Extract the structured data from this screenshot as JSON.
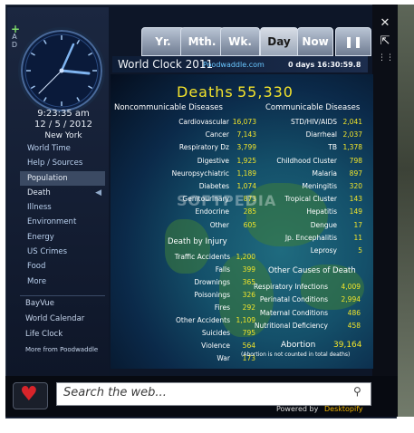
{
  "window_controls": {
    "close": "✕",
    "popout": "⇱",
    "grip": "⋮⋮"
  },
  "clock": {
    "time": "9:23:35 am",
    "date": "12 / 5 / 2012",
    "city": "New York",
    "add_label": "+",
    "ad_label": "A D"
  },
  "left_menu": {
    "items": [
      "World Time",
      "Help / Sources",
      "Population",
      "Death",
      "Illness",
      "Environment",
      "Energy",
      "US Crimes",
      "Food",
      "More"
    ],
    "selected": "Population",
    "current": "Death"
  },
  "bottom_menu": {
    "items": [
      "BayVue",
      "World Calendar",
      "Life Clock",
      "More from Poodwaddle"
    ]
  },
  "tabs": [
    "Yr.",
    "Mth.",
    "Wk.",
    "Day",
    "Now"
  ],
  "active_tab": "Day",
  "pause_icon": "pause-icon",
  "header": {
    "title": "World Clock 2011",
    "site": "Poodwaddle.com",
    "counter": "0 days 16:30:59.8"
  },
  "deaths": {
    "label": "Deaths",
    "value": "55,330"
  },
  "watermark": "SOFTPEDIA",
  "noncommunicable": {
    "title": "Noncommunicable Diseases",
    "rows": [
      {
        "label": "Cardiovascular",
        "value": "16,073"
      },
      {
        "label": "Cancer",
        "value": "7,143"
      },
      {
        "label": "Respiratory Dz",
        "value": "3,799"
      },
      {
        "label": "Digestive",
        "value": "1,925"
      },
      {
        "label": "Neuropsychiatric",
        "value": "1,189"
      },
      {
        "label": "Diabetes",
        "value": "1,074"
      },
      {
        "label": "Genitourinary",
        "value": "873"
      },
      {
        "label": "Endocrine",
        "value": "285"
      },
      {
        "label": "Other",
        "value": "605"
      }
    ]
  },
  "communicable": {
    "title": "Communicable Diseases",
    "rows": [
      {
        "label": "STD/HIV/AIDS",
        "value": "2,041"
      },
      {
        "label": "Diarrheal",
        "value": "2,037"
      },
      {
        "label": "TB",
        "value": "1,378"
      },
      {
        "label": "Childhood Cluster",
        "value": "798"
      },
      {
        "label": "Malaria",
        "value": "897"
      },
      {
        "label": "Meningitis",
        "value": "320"
      },
      {
        "label": "Tropical Cluster",
        "value": "143"
      },
      {
        "label": "Hepatitis",
        "value": "149"
      },
      {
        "label": "Dengue",
        "value": "17"
      },
      {
        "label": "Jp. Encephalitis",
        "value": "11"
      },
      {
        "label": "Leprosy",
        "value": "5"
      }
    ]
  },
  "injury": {
    "title": "Death by Injury",
    "rows": [
      {
        "label": "Traffic Accidents",
        "value": "1,200"
      },
      {
        "label": "Falls",
        "value": "399"
      },
      {
        "label": "Drownings",
        "value": "365"
      },
      {
        "label": "Poisonings",
        "value": "326"
      },
      {
        "label": "Fires",
        "value": "292"
      },
      {
        "label": "Other Accidents",
        "value": "1,109"
      },
      {
        "label": "Suicides",
        "value": "795"
      },
      {
        "label": "Violence",
        "value": "564"
      },
      {
        "label": "War",
        "value": "173"
      }
    ]
  },
  "other": {
    "title": "Other Causes of Death",
    "rows": [
      {
        "label": "Respiratory Infections",
        "value": "4,009"
      },
      {
        "label": "Perinatal Conditions",
        "value": "2,994"
      },
      {
        "label": "Maternal Conditions",
        "value": "486"
      },
      {
        "label": "Nutritional Deficiency",
        "value": "458"
      }
    ]
  },
  "abortion": {
    "label": "Abortion",
    "value": "39,164",
    "note": "(Abortion is not counted in total deaths)"
  },
  "search": {
    "placeholder": "Search the web..."
  },
  "footer": {
    "powered": "Powered by",
    "brand": "Desktopify"
  }
}
